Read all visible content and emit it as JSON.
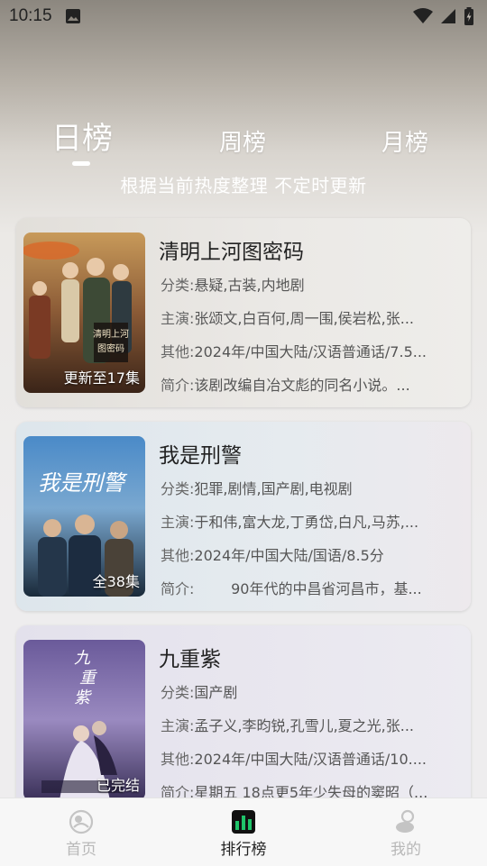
{
  "status_bar": {
    "time": "10:15"
  },
  "tabs": [
    {
      "label": "日榜",
      "active": true
    },
    {
      "label": "周榜",
      "active": false
    },
    {
      "label": "月榜",
      "active": false
    }
  ],
  "subtitle": "根据当前热度整理 不定时更新",
  "labels": {
    "category": "分类:",
    "cast": "主演:",
    "other": "其他:",
    "intro": "简介:"
  },
  "items": [
    {
      "title": "清明上河图密码",
      "badge": "更新至17集",
      "category": "悬疑,古装,内地剧",
      "cast": "张颂文,白百何,周一围,侯岩松,张...",
      "other": "2024年/中国大陆/汉语普通话/7.5...",
      "intro": "该剧改编自冶文彪的同名小说。...",
      "poster_text": "清明上河图密码"
    },
    {
      "title": "我是刑警",
      "badge": "全38集",
      "category": "犯罪,剧情,国产剧,电视剧",
      "cast": "于和伟,富大龙,丁勇岱,白凡,马苏,...",
      "other": "2024年/中国大陆/国语/8.5分",
      "intro": "        90年代的中昌省河昌市，基...",
      "poster_text": "我是刑警"
    },
    {
      "title": "九重紫",
      "badge": "已完结",
      "category": "国产剧",
      "cast": "孟子义,李昀锐,孔雪儿,夏之光,张...",
      "other": "2024年/中国大陆/汉语普通话/10....",
      "intro": "星期五 18点更5年少失母的窦昭（...",
      "poster_text": "九重紫"
    }
  ],
  "bottom_nav": [
    {
      "label": "首页",
      "icon": "home-icon",
      "active": false
    },
    {
      "label": "排行榜",
      "icon": "ranking-icon",
      "active": true
    },
    {
      "label": "我的",
      "icon": "profile-icon",
      "active": false
    }
  ],
  "colors": {
    "accent_green": "#1fc46a",
    "inactive": "#b8b8b8"
  }
}
